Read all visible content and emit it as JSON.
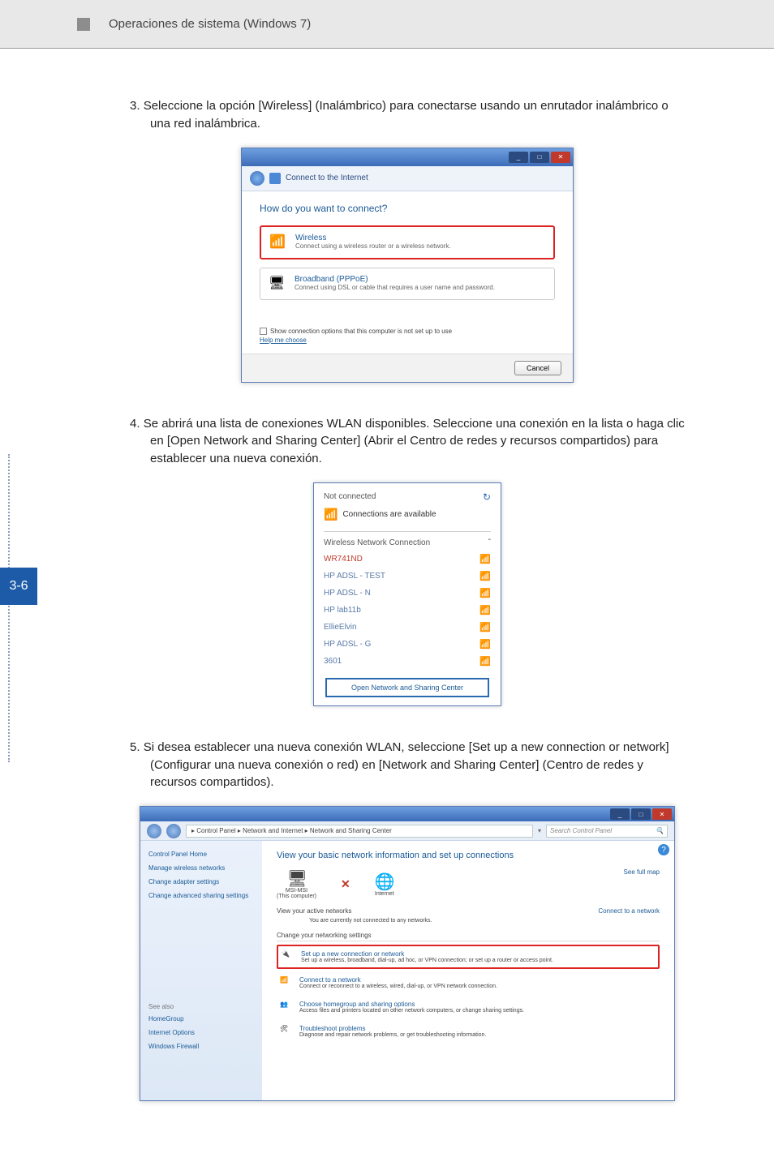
{
  "page_number_side": "3-6",
  "header_title": "Operaciones de sistema (Windows 7)",
  "steps": {
    "s3": {
      "num": "3.",
      "text": "Seleccione la opción [Wireless] (Inalámbrico) para conectarse usando un enrutador inalámbrico o una red inalámbrica."
    },
    "s4": {
      "num": "4.",
      "text": "Se abrirá una lista de conexiones WLAN disponibles. Seleccione una conexión en la lista o haga clic en [Open Network and Sharing Center] (Abrir el Centro de redes y recursos compartidos) para establecer una nueva conexión."
    },
    "s5": {
      "num": "5.",
      "text": "Si desea establecer una nueva conexión WLAN, seleccione [Set up a new connection or network] (Configurar una nueva conexión o red) en [Network and Sharing Center] (Centro de redes y recursos compartidos)."
    }
  },
  "ss1": {
    "title": "Connect to the Internet",
    "question": "How do you want to connect?",
    "opt_wireless_title": "Wireless",
    "opt_wireless_desc": "Connect using a wireless router or a wireless network.",
    "opt_broadband_title": "Broadband (PPPoE)",
    "opt_broadband_desc": "Connect using DSL or cable that requires a user name and password.",
    "checkbox_label": "Show connection options that this computer is not set up to use",
    "help": "Help me choose",
    "cancel": "Cancel"
  },
  "ss2": {
    "not_connected": "Not connected",
    "available": "Connections are available",
    "section": "Wireless Network Connection",
    "caret": "ˆ",
    "items": [
      {
        "name": "WR741ND",
        "cls": "first",
        "sig": "green"
      },
      {
        "name": "HP ADSL - TEST",
        "cls": "",
        "sig": "green"
      },
      {
        "name": "HP ADSL - N",
        "cls": "",
        "sig": "green"
      },
      {
        "name": "HP lab11b",
        "cls": "",
        "sig": "yellow"
      },
      {
        "name": "EllieElvin",
        "cls": "",
        "sig": "yellow"
      },
      {
        "name": "HP ADSL - G",
        "cls": "",
        "sig": "green"
      },
      {
        "name": "3601",
        "cls": "",
        "sig": "yellow"
      }
    ],
    "open_center": "Open Network and Sharing Center"
  },
  "ss3": {
    "breadcrumb": "  ▸ Control Panel ▸ Network and Internet ▸ Network and Sharing Center",
    "search_placeholder": "Search Control Panel",
    "side": {
      "home": "Control Panel Home",
      "links": [
        "Manage wireless networks",
        "Change adapter settings",
        "Change advanced sharing settings"
      ],
      "see_also_label": "See also",
      "see_also": [
        "HomeGroup",
        "Internet Options",
        "Windows Firewall"
      ]
    },
    "main": {
      "title": "View your basic network information and set up connections",
      "full_map": "See full map",
      "node1_label": "MSI-MSI",
      "node1_sub": "(This computer)",
      "node2_label": "Internet",
      "active_label": "View your active networks",
      "connect_link": "Connect to a network",
      "not_connected_msg": "You are currently not connected to any networks.",
      "change_title": "Change your networking settings",
      "tasks": [
        {
          "title": "Set up a new connection or network",
          "desc": "Set up a wireless, broadband, dial-up, ad hoc, or VPN connection; or set up a router or access point.",
          "highlight": true,
          "icon": "🔌"
        },
        {
          "title": "Connect to a network",
          "desc": "Connect or reconnect to a wireless, wired, dial-up, or VPN network connection.",
          "highlight": false,
          "icon": "📶"
        },
        {
          "title": "Choose homegroup and sharing options",
          "desc": "Access files and printers located on other network computers, or change sharing settings.",
          "highlight": false,
          "icon": "👥"
        },
        {
          "title": "Troubleshoot problems",
          "desc": "Diagnose and repair network problems, or get troubleshooting information.",
          "highlight": false,
          "icon": "🛠"
        }
      ]
    }
  }
}
